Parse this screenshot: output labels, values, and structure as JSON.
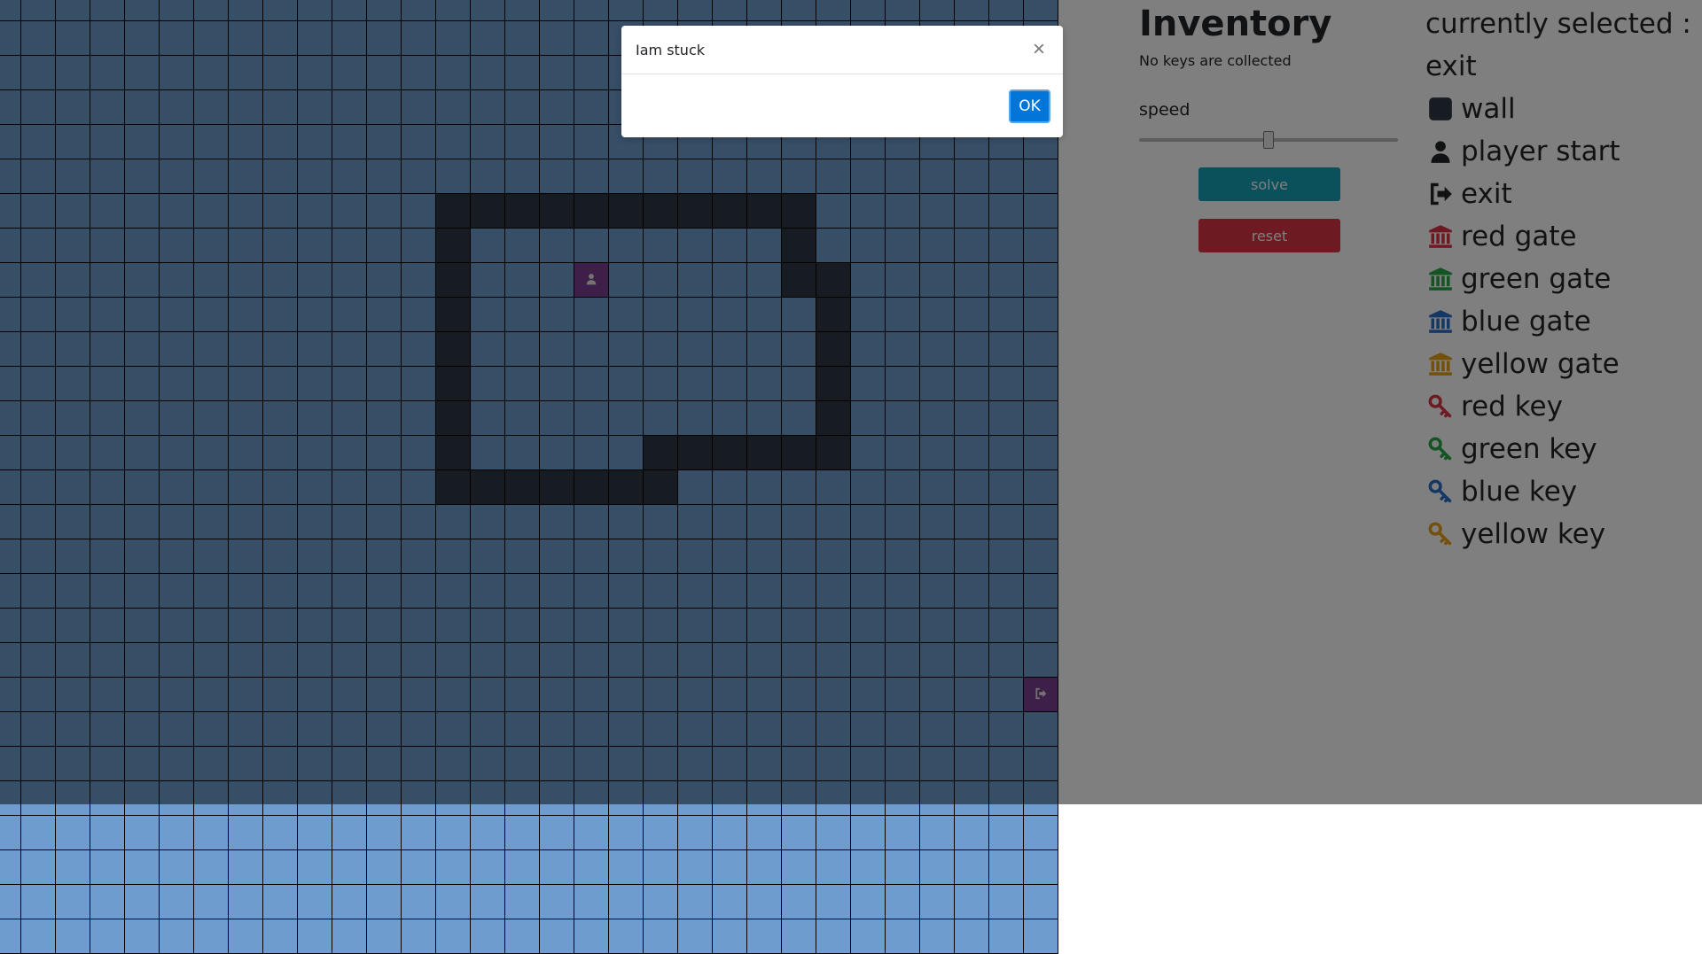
{
  "maze": {
    "cols": 31,
    "rows": 28,
    "floor_color": "#6f9ccf",
    "wall_color": "#2e3744",
    "special_color": "#7d3f92",
    "walls": [
      [
        13,
        6
      ],
      [
        14,
        6
      ],
      [
        15,
        6
      ],
      [
        16,
        6
      ],
      [
        17,
        6
      ],
      [
        18,
        6
      ],
      [
        19,
        6
      ],
      [
        20,
        6
      ],
      [
        21,
        6
      ],
      [
        22,
        6
      ],
      [
        23,
        6
      ],
      [
        13,
        7
      ],
      [
        23,
        7
      ],
      [
        13,
        8
      ],
      [
        23,
        8
      ],
      [
        24,
        8
      ],
      [
        13,
        9
      ],
      [
        24,
        9
      ],
      [
        13,
        10
      ],
      [
        24,
        10
      ],
      [
        13,
        11
      ],
      [
        24,
        11
      ],
      [
        13,
        12
      ],
      [
        24,
        12
      ],
      [
        13,
        13
      ],
      [
        19,
        13
      ],
      [
        20,
        13
      ],
      [
        21,
        13
      ],
      [
        22,
        13
      ],
      [
        23,
        13
      ],
      [
        24,
        13
      ],
      [
        13,
        14
      ],
      [
        14,
        14
      ],
      [
        15,
        14
      ],
      [
        16,
        14
      ],
      [
        17,
        14
      ],
      [
        18,
        14
      ],
      [
        19,
        14
      ]
    ],
    "player": [
      17,
      8
    ],
    "exit": [
      30,
      20
    ],
    "player_icon": "user-icon",
    "exit_icon": "sign-out-icon"
  },
  "inventory": {
    "title": "Inventory",
    "keys_text": "No keys are collected"
  },
  "speed": {
    "label": "speed",
    "value": 50
  },
  "buttons": {
    "solve": "solve",
    "reset": "reset"
  },
  "palette": {
    "selected_label": "currently selected :",
    "selected_value": "exit",
    "items": [
      {
        "label": "wall",
        "icon": "wall-icon",
        "color": "#2e3744"
      },
      {
        "label": "player start",
        "icon": "user-icon",
        "color": "#212529"
      },
      {
        "label": "exit",
        "icon": "sign-out-icon",
        "color": "#212529"
      },
      {
        "label": "red gate",
        "icon": "gate-icon",
        "color": "#dc3545"
      },
      {
        "label": "green gate",
        "icon": "gate-icon",
        "color": "#28a745"
      },
      {
        "label": "blue gate",
        "icon": "gate-icon",
        "color": "#2a6fc9"
      },
      {
        "label": "yellow gate",
        "icon": "gate-icon",
        "color": "#e8a317"
      },
      {
        "label": "red key",
        "icon": "key-icon",
        "color": "#dc3545"
      },
      {
        "label": "green key",
        "icon": "key-icon",
        "color": "#28a745"
      },
      {
        "label": "blue key",
        "icon": "key-icon",
        "color": "#2a6fc9"
      },
      {
        "label": "yellow key",
        "icon": "key-icon",
        "color": "#e8a317"
      }
    ]
  },
  "modal": {
    "title": "Iam stuck",
    "close": "×",
    "ok": "OK"
  }
}
